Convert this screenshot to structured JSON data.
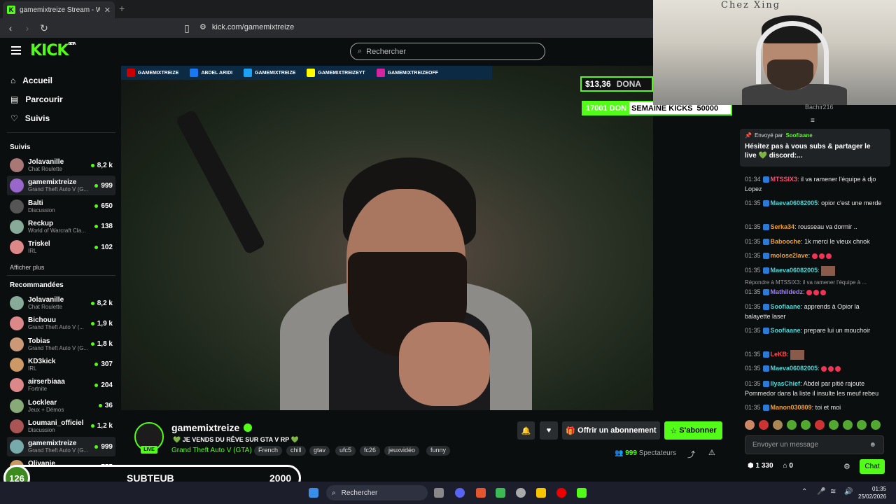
{
  "browser": {
    "tab_title": "gamemixtreize Stream - Watch L",
    "url": "kick.com/gamemixtreize"
  },
  "header": {
    "logo": "KICK",
    "logo_badge": "BETA",
    "search_placeholder": "Rechercher"
  },
  "nav": [
    {
      "label": "Accueil",
      "icon": "home-icon"
    },
    {
      "label": "Parcourir",
      "icon": "browse-icon"
    },
    {
      "label": "Suivis",
      "icon": "heart-icon"
    }
  ],
  "sidebar": {
    "followed_title": "Suivis",
    "followed": [
      {
        "name": "Jolavanille",
        "category": "Chat Roulette",
        "viewers": "8,2 k"
      },
      {
        "name": "gamemixtreize",
        "category": "Grand Theft Auto V (G...",
        "viewers": "999"
      },
      {
        "name": "Balti",
        "category": "Discussion",
        "viewers": "650"
      },
      {
        "name": "Reckup",
        "category": "World of Warcraft Cla...",
        "viewers": "138"
      },
      {
        "name": "Triskel",
        "category": "IRL",
        "viewers": "102"
      }
    ],
    "show_more": "Afficher plus",
    "recommended_title": "Recommandées",
    "recommended": [
      {
        "name": "Jolavanille",
        "category": "Chat Roulette",
        "viewers": "8,2 k"
      },
      {
        "name": "Bichouu",
        "category": "Grand Theft Auto V (...",
        "viewers": "1,9 k"
      },
      {
        "name": "Tobias",
        "category": "Grand Theft Auto V (G...",
        "viewers": "1,8 k"
      },
      {
        "name": "KD3kick",
        "category": "IRL",
        "viewers": "307"
      },
      {
        "name": "airserbiaaa",
        "category": "Fortnite",
        "viewers": "204"
      },
      {
        "name": "Locklear",
        "category": "Jeux + Démos",
        "viewers": "36"
      },
      {
        "name": "Loumani_officiel",
        "category": "Discussion",
        "viewers": "1,2 k"
      },
      {
        "name": "gamemixtreize",
        "category": "Grand Theft Auto V (G...",
        "viewers": "999"
      },
      {
        "name": "Olivanie",
        "category": "Grand Theft Auto V (G...",
        "viewers": "755"
      }
    ]
  },
  "overlay": {
    "socials": [
      "GAMEMIXTREIZE",
      "ABDEL ARIDI",
      "GAMEMIXTREIZE",
      "GAMEMIXTREIZEYT",
      "GAMEMIXTREIZEOFF"
    ],
    "money": "$13,36",
    "money_label": "DONA",
    "goal_left": "17001 DON",
    "goal_mid": "SEMAINE KICKS",
    "goal_right": "50000",
    "webcam_sign": "Chez Xing",
    "sub_goal_count": "126",
    "sub_goal_label": "SUBTEUB",
    "sub_goal_target": "2000"
  },
  "stream": {
    "name": "gamemixtreize",
    "title": "JE VENDS DU RÊVE SUR GTA V RP",
    "game": "Grand Theft Auto V (GTA)",
    "tags": [
      "French",
      "chill",
      "gtav",
      "ufc5",
      "fc26",
      "jeuxvidéo",
      "funny"
    ],
    "live": "LIVE",
    "gift_sub": "Offrir un abonnement",
    "subscribe": "S'abonner",
    "viewers_count": "999",
    "viewers_label": "Spectateurs"
  },
  "chat": {
    "top_user": "Bachir216",
    "pinned_header": "Envoyé par",
    "pinned_user": "Soofiaane",
    "pinned_msg": "Hésitez pas à vous subs & partager le live 💚 discord:...",
    "messages": [
      {
        "time": "01:34",
        "user": "MTSSIX3",
        "color": "#ff4d6d",
        "text": "il va ramener l'équipe à djo Lopez"
      },
      {
        "time": "01:35",
        "user": "Maeva06082005",
        "color": "#4fd6d6",
        "text": "opior c'est une merde"
      },
      {
        "time": "01:35",
        "user": "Serka34",
        "color": "#f0a030",
        "text": "rousseau va dormir .."
      },
      {
        "time": "01:35",
        "user": "Babooche",
        "color": "#f0a030",
        "text": "1k merci le vieux chnok"
      },
      {
        "time": "01:35",
        "user": "molose2lave",
        "color": "#f0a030",
        "text": ""
      },
      {
        "time": "01:35",
        "user": "Maeva06082005",
        "color": "#4fd6d6",
        "text": ""
      },
      {
        "time": "01:35",
        "user": "Mathildedz",
        "color": "#9f7cff",
        "text": ""
      },
      {
        "time": "01:35",
        "user": "Soofiaane",
        "color": "#4fd6d6",
        "text": "apprends à Opior la balayette laser"
      },
      {
        "time": "01:35",
        "user": "Soofiaane",
        "color": "#4fd6d6",
        "text": "prepare lui un mouchoir"
      },
      {
        "time": "01:35",
        "user": "LeKB",
        "color": "#ff4d4d",
        "text": ""
      },
      {
        "time": "01:35",
        "user": "Maeva06082005",
        "color": "#4fd6d6",
        "text": ""
      },
      {
        "time": "01:35",
        "user": "IlyasChief",
        "color": "#4fd6d6",
        "text": "Abdel par pitié rajoute Pommedor dans la liste il insulte les meuf rebeu"
      },
      {
        "time": "01:35",
        "user": "Manon030809",
        "color": "#f0a030",
        "text": "toi et moi"
      }
    ],
    "reply_note": "Répondre à MTSSIX3: il va ramener l'équipe à ...",
    "input_placeholder": "Envoyer un message",
    "points": "1 330",
    "gifts": "0",
    "chat_button": "Chat"
  },
  "taskbar": {
    "search": "Rechercher",
    "time": "01:35",
    "date": "25/02/2026"
  }
}
